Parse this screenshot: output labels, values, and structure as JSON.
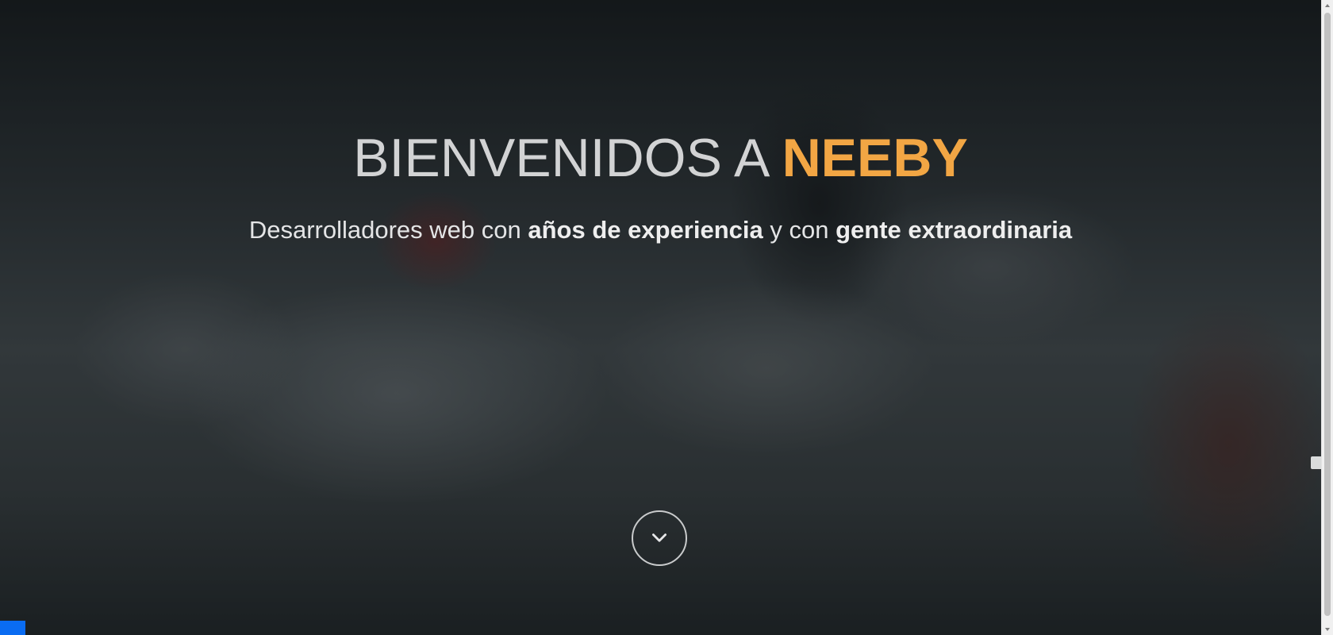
{
  "hero": {
    "title_prefix": "BIENVENIDOS A ",
    "title_brand": "NEEBY",
    "subtitle_parts": {
      "p1": "Desarrolladores web con ",
      "b1": "años de experiencia",
      "p2": " y con ",
      "b2": "gente extraordinaria"
    },
    "scroll_icon": "chevron-down-icon"
  },
  "colors": {
    "brand": "#f2a644",
    "title": "#d2d3d4",
    "corner_widget": "#0a6cf2"
  }
}
